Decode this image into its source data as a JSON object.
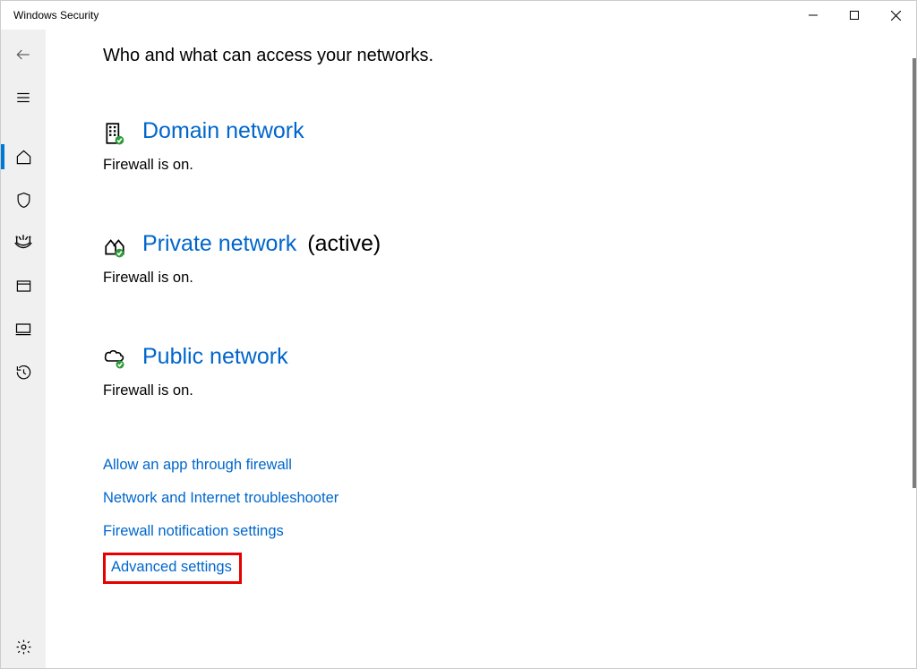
{
  "window": {
    "title": "Windows Security"
  },
  "header_subtitle": "Who and what can access your networks.",
  "sections": {
    "domain": {
      "title": "Domain network",
      "status": "Firewall is on."
    },
    "private": {
      "title": "Private network",
      "active_label": "(active)",
      "status": "Firewall is on."
    },
    "public": {
      "title": "Public network",
      "status": "Firewall is on."
    }
  },
  "links": {
    "allow_app": "Allow an app through firewall",
    "troubleshoot": "Network and Internet troubleshooter",
    "notify": "Firewall notification settings",
    "advanced": "Advanced settings"
  },
  "colors": {
    "link": "#0066cc",
    "highlight": "#e60000",
    "sidebar_bg": "#f0f0f0",
    "active_bar": "#0078d4"
  }
}
